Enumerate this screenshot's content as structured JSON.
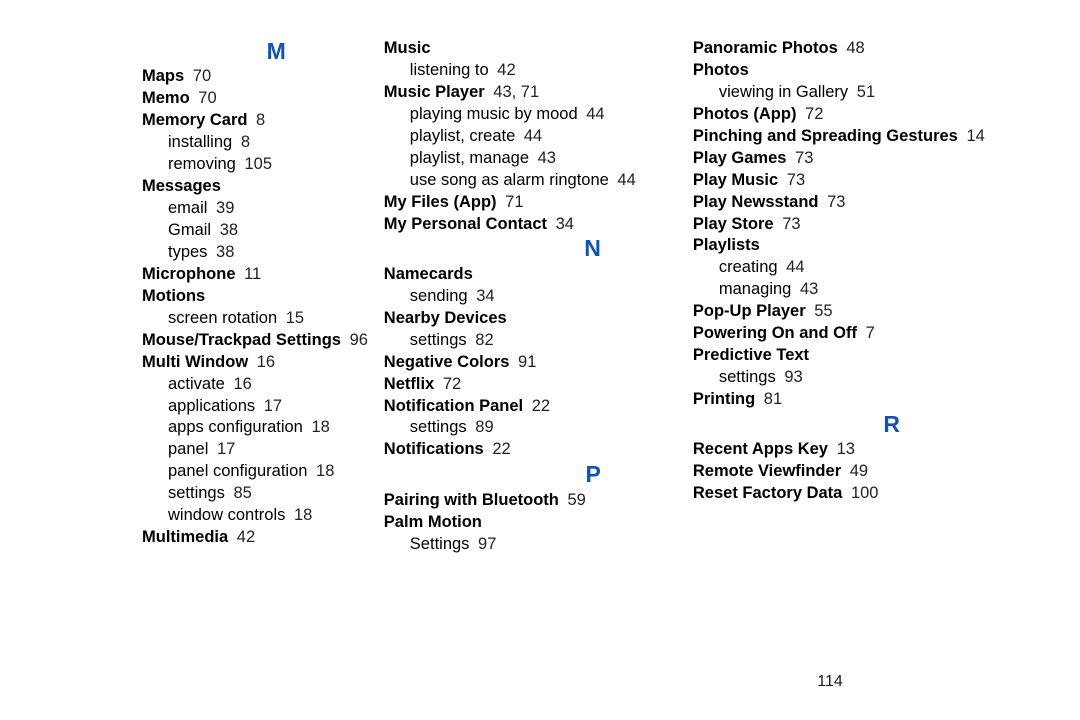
{
  "page_number": "114",
  "columns": [
    {
      "id": "col1",
      "sections": [
        {
          "letter": "M",
          "entries": [
            {
              "topic": "Maps",
              "pages": "70"
            },
            {
              "topic": "Memo",
              "pages": "70"
            },
            {
              "topic": "Memory Card",
              "pages": "8",
              "sub": [
                {
                  "topic": "installing",
                  "pages": "8"
                },
                {
                  "topic": "removing",
                  "pages": "105"
                }
              ]
            },
            {
              "topic": "Messages",
              "pages": "",
              "sub": [
                {
                  "topic": "email",
                  "pages": "39"
                },
                {
                  "topic": "Gmail",
                  "pages": "38"
                },
                {
                  "topic": "types",
                  "pages": "38"
                }
              ]
            },
            {
              "topic": "Microphone",
              "pages": "11"
            },
            {
              "topic": "Motions",
              "pages": "",
              "sub": [
                {
                  "topic": "screen rotation",
                  "pages": "15"
                }
              ]
            },
            {
              "topic": "Mouse/Trackpad Settings",
              "pages": "96"
            },
            {
              "topic": "Multi Window",
              "pages": "16",
              "sub": [
                {
                  "topic": "activate",
                  "pages": "16"
                },
                {
                  "topic": "applications",
                  "pages": "17"
                },
                {
                  "topic": "apps configuration",
                  "pages": "18"
                },
                {
                  "topic": "panel",
                  "pages": "17"
                },
                {
                  "topic": "panel configuration",
                  "pages": "18"
                },
                {
                  "topic": "settings",
                  "pages": "85"
                },
                {
                  "topic": "window controls",
                  "pages": "18"
                }
              ]
            },
            {
              "topic": "Multimedia",
              "pages": "42"
            }
          ]
        }
      ]
    },
    {
      "id": "col2",
      "sections": [
        {
          "letter": "",
          "entries": [
            {
              "topic": "Music",
              "pages": "",
              "sub": [
                {
                  "topic": "listening to",
                  "pages": "42"
                }
              ]
            },
            {
              "topic": "Music Player",
              "pages": "43, 71",
              "sub": [
                {
                  "topic": "playing music by mood",
                  "pages": "44"
                },
                {
                  "topic": "playlist, create",
                  "pages": "44"
                },
                {
                  "topic": "playlist, manage",
                  "pages": "43"
                },
                {
                  "topic": "use song as alarm ringtone",
                  "pages": "44"
                }
              ]
            },
            {
              "topic": "My Files (App)",
              "pages": "71"
            },
            {
              "topic": "My Personal Contact",
              "pages": "34"
            }
          ]
        },
        {
          "letter": "N",
          "entries": [
            {
              "topic": "Namecards",
              "pages": "",
              "sub": [
                {
                  "topic": "sending",
                  "pages": "34"
                }
              ]
            },
            {
              "topic": "Nearby Devices",
              "pages": "",
              "sub": [
                {
                  "topic": "settings",
                  "pages": "82"
                }
              ]
            },
            {
              "topic": "Negative Colors",
              "pages": "91"
            },
            {
              "topic": "Netflix",
              "pages": "72"
            },
            {
              "topic": "Notification Panel",
              "pages": "22",
              "sub": [
                {
                  "topic": "settings",
                  "pages": "89"
                }
              ]
            },
            {
              "topic": "Notifications",
              "pages": "22"
            }
          ]
        },
        {
          "letter": "P",
          "entries": [
            {
              "topic": "Pairing with Bluetooth",
              "pages": "59"
            },
            {
              "topic": "Palm Motion",
              "pages": "",
              "sub": [
                {
                  "topic": "Settings",
                  "pages": "97"
                }
              ]
            }
          ]
        }
      ]
    },
    {
      "id": "col3",
      "sections": [
        {
          "letter": "",
          "entries": [
            {
              "topic": "Panoramic Photos",
              "pages": "48"
            },
            {
              "topic": "Photos",
              "pages": "",
              "sub": [
                {
                  "topic": "viewing in Gallery",
                  "pages": "51"
                }
              ]
            },
            {
              "topic": "Photos (App)",
              "pages": "72"
            },
            {
              "topic": "Pinching and Spreading Gestures",
              "pages": "14"
            },
            {
              "topic": "Play Games",
              "pages": "73"
            },
            {
              "topic": "Play Music",
              "pages": "73"
            },
            {
              "topic": "Play Newsstand",
              "pages": "73"
            },
            {
              "topic": "Play Store",
              "pages": "73"
            },
            {
              "topic": "Playlists",
              "pages": "",
              "sub": [
                {
                  "topic": "creating",
                  "pages": "44"
                },
                {
                  "topic": "managing",
                  "pages": "43"
                }
              ]
            },
            {
              "topic": "Pop-Up Player",
              "pages": "55"
            },
            {
              "topic": "Powering On and Off",
              "pages": "7"
            },
            {
              "topic": "Predictive Text",
              "pages": "",
              "sub": [
                {
                  "topic": "settings",
                  "pages": "93"
                }
              ]
            },
            {
              "topic": "Printing",
              "pages": "81"
            }
          ]
        },
        {
          "letter": "R",
          "entries": [
            {
              "topic": "Recent Apps Key",
              "pages": "13"
            },
            {
              "topic": "Remote Viewfinder",
              "pages": "49"
            },
            {
              "topic": "Reset Factory Data",
              "pages": "100"
            }
          ]
        }
      ]
    }
  ]
}
